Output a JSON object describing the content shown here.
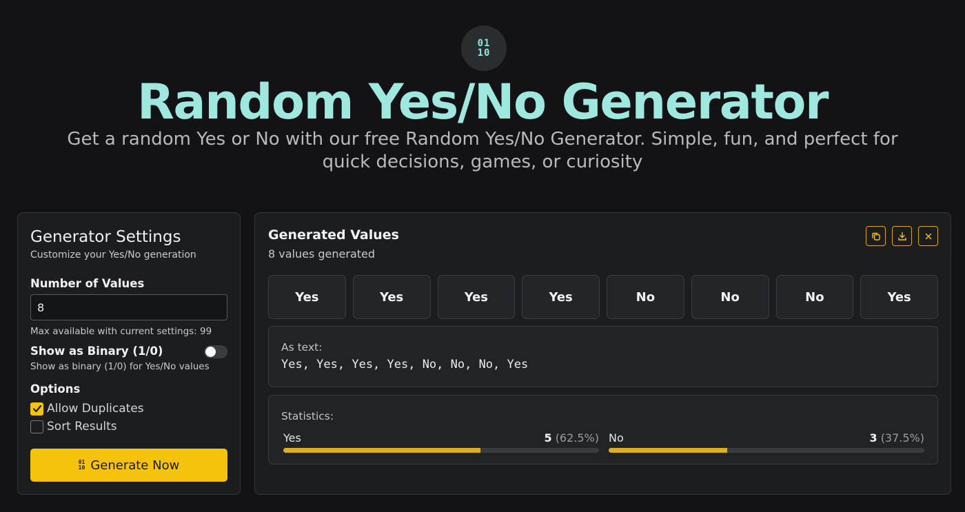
{
  "header": {
    "logo_line1": "01",
    "logo_line2": "10",
    "title": "Random Yes/No Generator",
    "subtitle": "Get a random Yes or No with our free Random Yes/No Generator. Simple, fun, and perfect for quick decisions, games, or curiosity"
  },
  "settings": {
    "title": "Generator Settings",
    "subtitle": "Customize your Yes/No generation",
    "number_label": "Number of Values",
    "number_value": "8",
    "number_hint": "Max available with current settings: 99",
    "binary_label": "Show as Binary (1/0)",
    "binary_hint": "Show as binary (1/0) for Yes/No values",
    "binary_enabled": false,
    "options_label": "Options",
    "allow_duplicates_label": "Allow Duplicates",
    "allow_duplicates_checked": true,
    "sort_results_label": "Sort Results",
    "sort_results_checked": false,
    "generate_label": "Generate Now",
    "icons": [
      "binary-icon",
      "check-icon"
    ]
  },
  "results": {
    "title": "Generated Values",
    "count_text": "8 values generated",
    "toolbar_icons": [
      "copy-icon",
      "download-icon",
      "close-icon"
    ],
    "values": [
      "Yes",
      "Yes",
      "Yes",
      "Yes",
      "No",
      "No",
      "No",
      "Yes"
    ],
    "as_text_label": "As text:",
    "as_text_value": "Yes, Yes, Yes, Yes, No, No, No, Yes",
    "statistics_label": "Statistics:",
    "stats": [
      {
        "label": "Yes",
        "count": "5",
        "percent": "(62.5%)",
        "fraction": 0.625
      },
      {
        "label": "No",
        "count": "3",
        "percent": "(37.5%)",
        "fraction": 0.375
      }
    ]
  },
  "colors": {
    "accent": "#f5c30c",
    "title": "#9fe8df",
    "background": "#131315"
  }
}
